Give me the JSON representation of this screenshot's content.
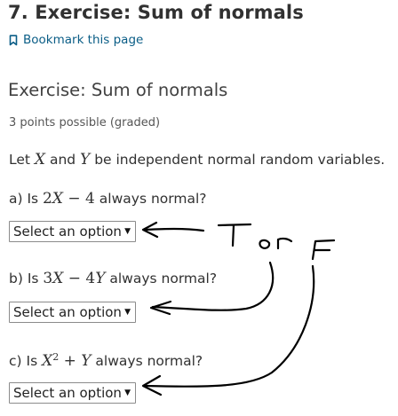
{
  "page": {
    "unit_title": "7. Exercise: Sum of normals",
    "bookmark_label": "Bookmark this page"
  },
  "problem": {
    "title": "Exercise: Sum of normals",
    "points": "3 points possible (graded)",
    "statement": {
      "prefix": "Let ",
      "var_x": "X",
      "and": " and ",
      "var_y": "Y",
      "suffix": " be independent normal random variables."
    },
    "questions": [
      {
        "prefix": "a) Is ",
        "math_coef": "2",
        "math_var": "X",
        "math_rest": " − 4",
        "suffix": " always normal?",
        "select_value": "Select an option"
      },
      {
        "prefix": "b) Is ",
        "math_coef": "3",
        "math_var": "X",
        "math_mid": " − 4",
        "math_var2": "Y",
        "suffix": " always normal?",
        "select_value": "Select an option"
      },
      {
        "prefix": "c) Is ",
        "math_var": "X",
        "math_sup": "2",
        "math_mid": " + ",
        "math_var2": "Y",
        "suffix": " always normal?",
        "select_value": "Select an option"
      }
    ]
  },
  "annotation": {
    "handwritten_text": "T or F",
    "ink_color": "#000000"
  },
  "colors": {
    "link": "#0a5d86",
    "text": "#313131"
  }
}
